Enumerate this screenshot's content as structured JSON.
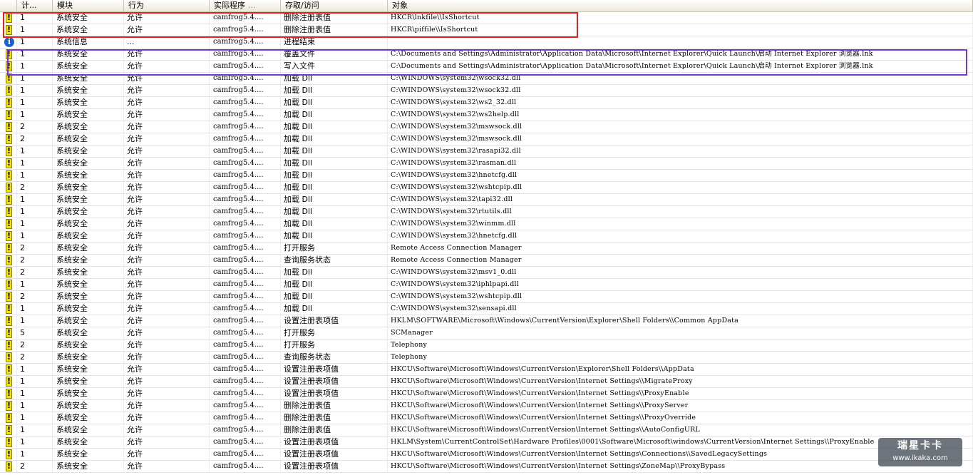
{
  "columns": {
    "count": "计...",
    "module": "模块",
    "action": "行为",
    "program": "实际程序",
    "program_dots": "...",
    "access": "存取/访问",
    "object": "对象"
  },
  "rows": [
    {
      "icon": "warning",
      "count": "1",
      "module": "系统安全",
      "action": "允许",
      "program": "camfrog5.4....",
      "access": "删除注册表值",
      "object": "HKCR\\lnkfile\\\\IsShortcut"
    },
    {
      "icon": "warning",
      "count": "1",
      "module": "系统安全",
      "action": "允许",
      "program": "camfrog5.4....",
      "access": "删除注册表值",
      "object": "HKCR\\piffile\\\\IsShortcut"
    },
    {
      "icon": "info",
      "count": "1",
      "module": "系统信息",
      "action": "...",
      "program": "camfrog5.4....",
      "access": "进程结束",
      "object": ""
    },
    {
      "icon": "warning",
      "count": "1",
      "module": "系统安全",
      "action": "允许",
      "program": "camfrog5.4....",
      "access": "覆盖文件",
      "object": "C:\\Documents and Settings\\Administrator\\Application Data\\Microsoft\\Internet Explorer\\Quick Launch\\启动 Internet Explorer 浏览器.lnk"
    },
    {
      "icon": "warning",
      "count": "1",
      "module": "系统安全",
      "action": "允许",
      "program": "camfrog5.4....",
      "access": "写入文件",
      "object": "C:\\Documents and Settings\\Administrator\\Application Data\\Microsoft\\Internet Explorer\\Quick Launch\\启动 Internet Explorer 浏览器.lnk"
    },
    {
      "icon": "warning",
      "count": "1",
      "module": "系统安全",
      "action": "允许",
      "program": "camfrog5.4....",
      "access": "加载 Dll",
      "object": "C:\\WINDOWS\\system32\\wsock32.dll"
    },
    {
      "icon": "warning",
      "count": "1",
      "module": "系统安全",
      "action": "允许",
      "program": "camfrog5.4....",
      "access": "加载 Dll",
      "object": "C:\\WINDOWS\\system32\\wsock32.dll"
    },
    {
      "icon": "warning",
      "count": "1",
      "module": "系统安全",
      "action": "允许",
      "program": "camfrog5.4....",
      "access": "加载 Dll",
      "object": "C:\\WINDOWS\\system32\\ws2_32.dll"
    },
    {
      "icon": "warning",
      "count": "1",
      "module": "系统安全",
      "action": "允许",
      "program": "camfrog5.4....",
      "access": "加载 Dll",
      "object": "C:\\WINDOWS\\system32\\ws2help.dll"
    },
    {
      "icon": "warning",
      "count": "2",
      "module": "系统安全",
      "action": "允许",
      "program": "camfrog5.4....",
      "access": "加载 Dll",
      "object": "C:\\WINDOWS\\system32\\mswsock.dll"
    },
    {
      "icon": "warning",
      "count": "2",
      "module": "系统安全",
      "action": "允许",
      "program": "camfrog5.4....",
      "access": "加载 Dll",
      "object": "C:\\WINDOWS\\system32\\mswsock.dll"
    },
    {
      "icon": "warning",
      "count": "1",
      "module": "系统安全",
      "action": "允许",
      "program": "camfrog5.4....",
      "access": "加载 Dll",
      "object": "C:\\WINDOWS\\system32\\rasapi32.dll"
    },
    {
      "icon": "warning",
      "count": "1",
      "module": "系统安全",
      "action": "允许",
      "program": "camfrog5.4....",
      "access": "加载 Dll",
      "object": "C:\\WINDOWS\\system32\\rasman.dll"
    },
    {
      "icon": "warning",
      "count": "1",
      "module": "系统安全",
      "action": "允许",
      "program": "camfrog5.4....",
      "access": "加载 Dll",
      "object": "C:\\WINDOWS\\system32\\hnetcfg.dll"
    },
    {
      "icon": "warning",
      "count": "2",
      "module": "系统安全",
      "action": "允许",
      "program": "camfrog5.4....",
      "access": "加载 Dll",
      "object": "C:\\WINDOWS\\system32\\wshtcpip.dll"
    },
    {
      "icon": "warning",
      "count": "1",
      "module": "系统安全",
      "action": "允许",
      "program": "camfrog5.4....",
      "access": "加载 Dll",
      "object": "C:\\WINDOWS\\system32\\tapi32.dll"
    },
    {
      "icon": "warning",
      "count": "1",
      "module": "系统安全",
      "action": "允许",
      "program": "camfrog5.4....",
      "access": "加载 Dll",
      "object": "C:\\WINDOWS\\system32\\rtutils.dll"
    },
    {
      "icon": "warning",
      "count": "1",
      "module": "系统安全",
      "action": "允许",
      "program": "camfrog5.4....",
      "access": "加载 Dll",
      "object": "C:\\WINDOWS\\system32\\winmm.dll"
    },
    {
      "icon": "warning",
      "count": "1",
      "module": "系统安全",
      "action": "允许",
      "program": "camfrog5.4....",
      "access": "加载 Dll",
      "object": "C:\\WINDOWS\\system32\\hnetcfg.dll"
    },
    {
      "icon": "warning",
      "count": "2",
      "module": "系统安全",
      "action": "允许",
      "program": "camfrog5.4....",
      "access": "打开服务",
      "object": "Remote Access Connection Manager"
    },
    {
      "icon": "warning",
      "count": "2",
      "module": "系统安全",
      "action": "允许",
      "program": "camfrog5.4....",
      "access": "查询服务状态",
      "object": "Remote Access Connection Manager"
    },
    {
      "icon": "warning",
      "count": "2",
      "module": "系统安全",
      "action": "允许",
      "program": "camfrog5.4....",
      "access": "加载 Dll",
      "object": "C:\\WINDOWS\\system32\\msv1_0.dll"
    },
    {
      "icon": "warning",
      "count": "1",
      "module": "系统安全",
      "action": "允许",
      "program": "camfrog5.4....",
      "access": "加载 Dll",
      "object": "C:\\WINDOWS\\system32\\iphlpapi.dll"
    },
    {
      "icon": "warning",
      "count": "2",
      "module": "系统安全",
      "action": "允许",
      "program": "camfrog5.4....",
      "access": "加载 Dll",
      "object": "C:\\WINDOWS\\system32\\wshtcpip.dll"
    },
    {
      "icon": "warning",
      "count": "1",
      "module": "系统安全",
      "action": "允许",
      "program": "camfrog5.4....",
      "access": "加载 Dll",
      "object": "C:\\WINDOWS\\system32\\sensapi.dll"
    },
    {
      "icon": "warning",
      "count": "1",
      "module": "系统安全",
      "action": "允许",
      "program": "camfrog5.4....",
      "access": "设置注册表项值",
      "object": "HKLM\\SOFTWARE\\Microsoft\\Windows\\CurrentVersion\\Explorer\\Shell Folders\\\\Common AppData"
    },
    {
      "icon": "warning",
      "count": "5",
      "module": "系统安全",
      "action": "允许",
      "program": "camfrog5.4....",
      "access": "打开服务",
      "object": "SCManager"
    },
    {
      "icon": "warning",
      "count": "2",
      "module": "系统安全",
      "action": "允许",
      "program": "camfrog5.4....",
      "access": "打开服务",
      "object": "Telephony"
    },
    {
      "icon": "warning",
      "count": "2",
      "module": "系统安全",
      "action": "允许",
      "program": "camfrog5.4....",
      "access": "查询服务状态",
      "object": "Telephony"
    },
    {
      "icon": "warning",
      "count": "1",
      "module": "系统安全",
      "action": "允许",
      "program": "camfrog5.4....",
      "access": "设置注册表项值",
      "object": "HKCU\\Software\\Microsoft\\Windows\\CurrentVersion\\Explorer\\Shell Folders\\\\AppData"
    },
    {
      "icon": "warning",
      "count": "1",
      "module": "系统安全",
      "action": "允许",
      "program": "camfrog5.4....",
      "access": "设置注册表项值",
      "object": "HKCU\\Software\\Microsoft\\Windows\\CurrentVersion\\Internet Settings\\\\MigrateProxy"
    },
    {
      "icon": "warning",
      "count": "1",
      "module": "系统安全",
      "action": "允许",
      "program": "camfrog5.4....",
      "access": "设置注册表项值",
      "object": "HKCU\\Software\\Microsoft\\Windows\\CurrentVersion\\Internet Settings\\\\ProxyEnable"
    },
    {
      "icon": "warning",
      "count": "1",
      "module": "系统安全",
      "action": "允许",
      "program": "camfrog5.4....",
      "access": "删除注册表值",
      "object": "HKCU\\Software\\Microsoft\\Windows\\CurrentVersion\\Internet Settings\\\\ProxyServer"
    },
    {
      "icon": "warning",
      "count": "1",
      "module": "系统安全",
      "action": "允许",
      "program": "camfrog5.4....",
      "access": "删除注册表值",
      "object": "HKCU\\Software\\Microsoft\\Windows\\CurrentVersion\\Internet Settings\\\\ProxyOverride"
    },
    {
      "icon": "warning",
      "count": "1",
      "module": "系统安全",
      "action": "允许",
      "program": "camfrog5.4....",
      "access": "删除注册表值",
      "object": "HKCU\\Software\\Microsoft\\Windows\\CurrentVersion\\Internet Settings\\\\AutoConfigURL"
    },
    {
      "icon": "warning",
      "count": "1",
      "module": "系统安全",
      "action": "允许",
      "program": "camfrog5.4....",
      "access": "设置注册表项值",
      "object": "HKLM\\System\\CurrentControlSet\\Hardware Profiles\\0001\\Software\\Microsoft\\windows\\CurrentVersion\\Internet Settings\\\\ProxyEnable"
    },
    {
      "icon": "warning",
      "count": "1",
      "module": "系统安全",
      "action": "允许",
      "program": "camfrog5.4....",
      "access": "设置注册表项值",
      "object": "HKCU\\Software\\Microsoft\\Windows\\CurrentVersion\\Internet Settings\\Connections\\\\SavedLegacySettings"
    },
    {
      "icon": "warning",
      "count": "2",
      "module": "系统安全",
      "action": "允许",
      "program": "camfrog5.4....",
      "access": "设置注册表项值",
      "object": "HKCU\\Software\\Microsoft\\Windows\\CurrentVersion\\Internet Settings\\ZoneMap\\\\ProxyBypass"
    }
  ],
  "watermark": {
    "logo": "瑞星卡卡",
    "url": "www.ikaka.com"
  },
  "colors": {
    "warning": "#f5e400",
    "info": "#1c5fd1",
    "highlight_red": "#e8201d",
    "highlight_purple": "#7a33d6"
  }
}
